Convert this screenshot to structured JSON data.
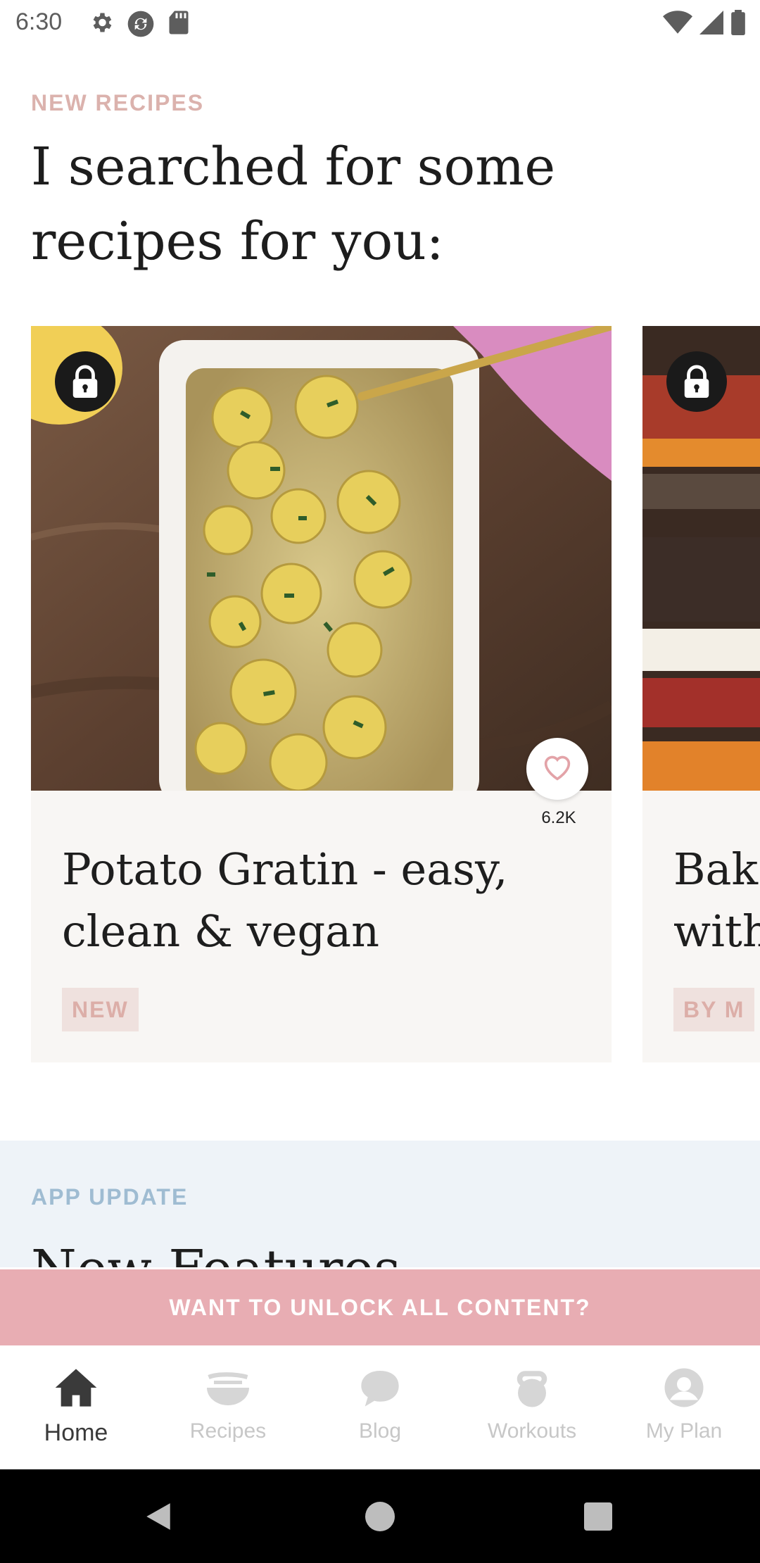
{
  "status_bar": {
    "time": "6:30",
    "left_icons": [
      "gear-icon",
      "sync-icon",
      "sd-card-icon"
    ],
    "right_icons": [
      "wifi-icon",
      "signal-icon",
      "battery-icon"
    ]
  },
  "new_recipes": {
    "label": "NEW RECIPES",
    "headline": "I searched for some recipes for you:",
    "cards": [
      {
        "title": "Potato Gratin - easy, clean & vegan",
        "badge": "NEW",
        "likes": "6.2K",
        "locked": true
      },
      {
        "title": "Bak\nwith",
        "badge": "BY M",
        "locked": true
      }
    ]
  },
  "app_update": {
    "label": "APP UPDATE",
    "title": "New Features"
  },
  "unlock_banner": {
    "label": "WANT TO UNLOCK ALL CONTENT?"
  },
  "bottom_nav": {
    "items": [
      {
        "label": "Home",
        "icon": "home-icon",
        "active": true
      },
      {
        "label": "Recipes",
        "icon": "bowl-icon",
        "active": false
      },
      {
        "label": "Blog",
        "icon": "chat-bubble-icon",
        "active": false
      },
      {
        "label": "Workouts",
        "icon": "kettlebell-icon",
        "active": false
      },
      {
        "label": "My Plan",
        "icon": "profile-icon",
        "active": false
      }
    ]
  },
  "colors": {
    "accent_pink": "#e8adb3",
    "label_pink": "#dbb2ad",
    "label_blue": "#9fbcd2"
  }
}
